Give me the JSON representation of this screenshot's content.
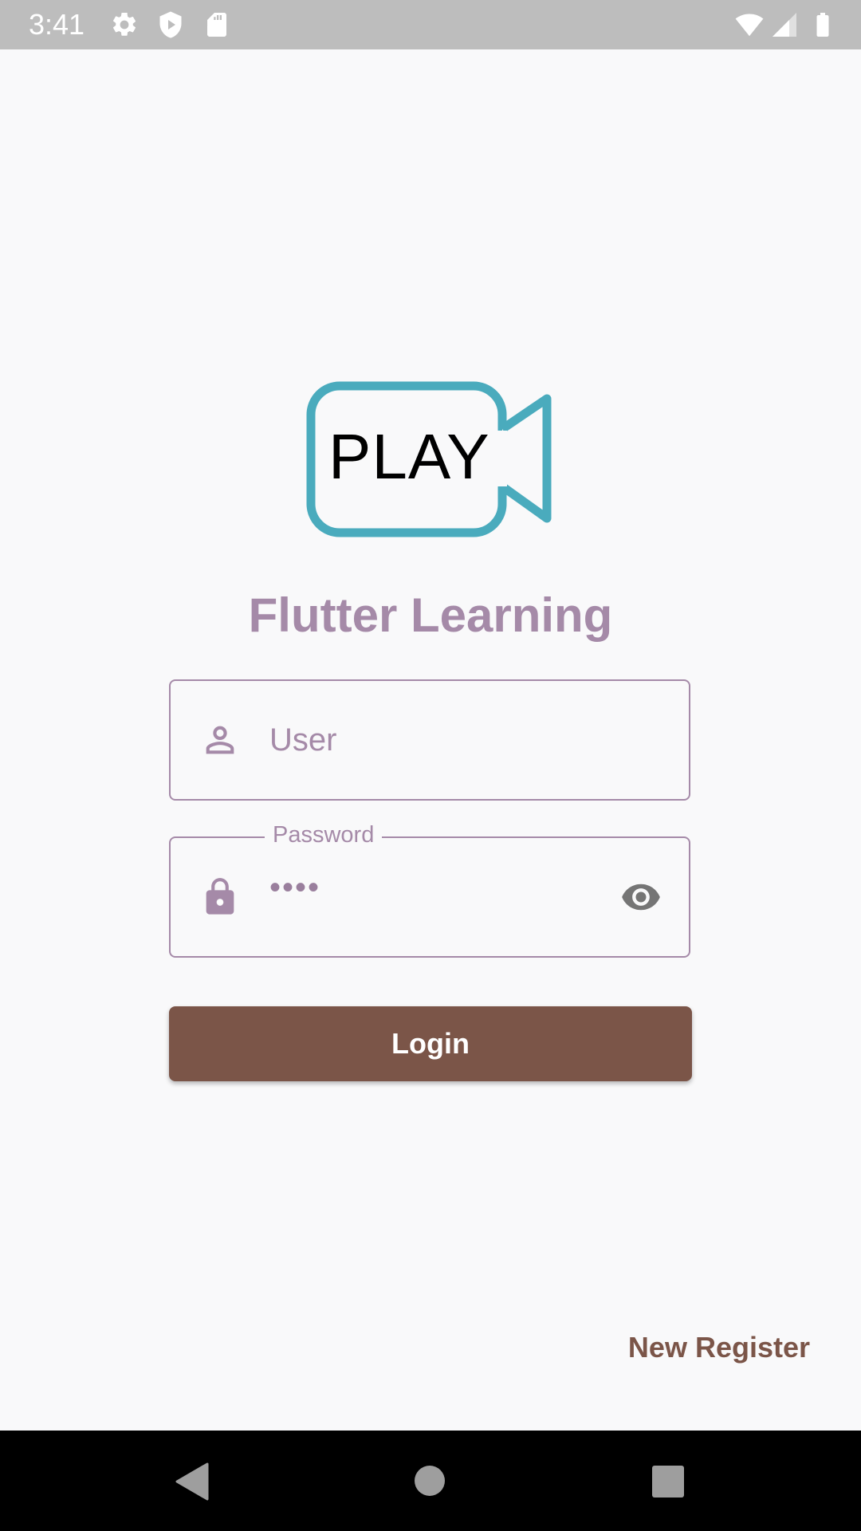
{
  "status_bar": {
    "time": "3:41",
    "left_icons": [
      "settings-icon",
      "shield-play-icon",
      "sd-card-icon"
    ],
    "right_icons": [
      "wifi-icon",
      "cell-signal-icon",
      "battery-icon"
    ],
    "background": "#bdbdbd"
  },
  "logo": {
    "text": "PLAY",
    "icon": "video-camera-icon",
    "stroke_color": "#4aabbd"
  },
  "app": {
    "title": "Flutter Learning",
    "accent_color": "#a58aa8"
  },
  "form": {
    "user": {
      "placeholder": "User",
      "icon": "person-icon"
    },
    "password": {
      "label": "Password",
      "value": "••••",
      "icon": "lock-icon",
      "toggle_icon": "eye-icon"
    },
    "login_label": "Login",
    "login_color": "#7b5548",
    "register_label": "New Register"
  },
  "nav_bar": {
    "icons": [
      "back-icon",
      "home-icon",
      "recents-icon"
    ]
  }
}
